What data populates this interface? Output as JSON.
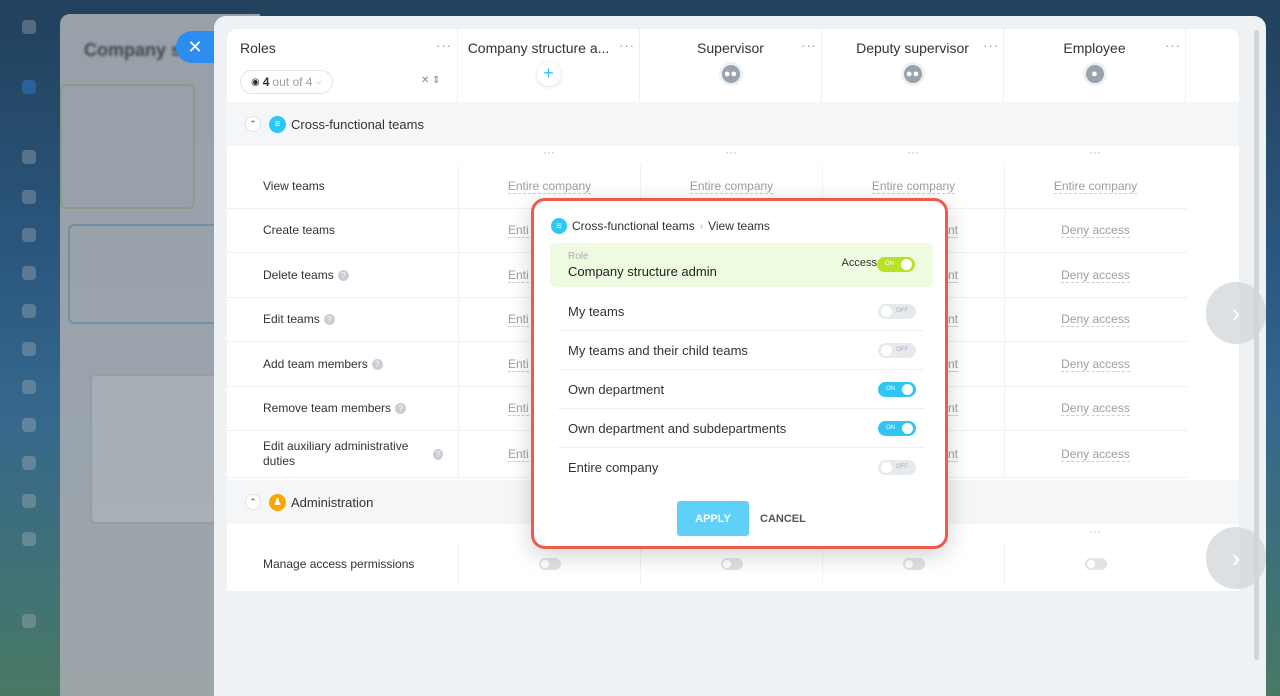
{
  "header": {
    "roles_label": "Roles",
    "filter": {
      "count": "4",
      "suffix": "out of 4"
    },
    "columns": [
      {
        "label": "Company structure a...",
        "icon": "plus-icon"
      },
      {
        "label": "Supervisor",
        "icon": "group-icon"
      },
      {
        "label": "Deputy supervisor",
        "icon": "group-icon"
      },
      {
        "label": "Employee",
        "icon": "person-icon"
      }
    ],
    "more": "···"
  },
  "sections": [
    {
      "label": "Cross-functional teams",
      "color": "#2fc6f6",
      "icon": "teams-icon"
    },
    {
      "label": "Administration",
      "color": "#f7a700",
      "icon": "admin-icon"
    }
  ],
  "rows": [
    {
      "name": "View teams",
      "help": false,
      "values": [
        "Entire company",
        "Entire company",
        "Entire company",
        "Entire company"
      ]
    },
    {
      "name": "Create teams",
      "help": false,
      "values": [
        "Enti",
        "",
        "nt",
        "Deny access"
      ]
    },
    {
      "name": "Delete teams",
      "help": true,
      "values": [
        "Enti",
        "",
        "nt",
        "Deny access"
      ]
    },
    {
      "name": "Edit teams",
      "help": true,
      "values": [
        "Enti",
        "",
        "nt",
        "Deny access"
      ]
    },
    {
      "name": "Add team members",
      "help": true,
      "values": [
        "Enti",
        "",
        "nt",
        "Deny access"
      ]
    },
    {
      "name": "Remove team members",
      "help": true,
      "values": [
        "Enti",
        "",
        "nt",
        "Deny access"
      ]
    },
    {
      "name": "Edit auxiliary administrative duties",
      "help": true,
      "values": [
        "Enti",
        "",
        "nt",
        "Deny access"
      ]
    }
  ],
  "admin_row": {
    "name": "Manage access permissions"
  },
  "popup": {
    "crumb_section": "Cross-functional teams",
    "crumb_item": "View teams",
    "role_small": "Role",
    "role_name": "Company structure admin",
    "access_label": "Access",
    "access_on": "ON",
    "options": [
      {
        "label": "My teams",
        "state": "OFF"
      },
      {
        "label": "My teams and their child teams",
        "state": "OFF"
      },
      {
        "label": "Own department",
        "state": "ON"
      },
      {
        "label": "Own department and subdepartments",
        "state": "ON"
      },
      {
        "label": "Entire company",
        "state": "OFF"
      }
    ],
    "apply": "APPLY",
    "cancel": "CANCEL"
  },
  "colors": {
    "accent": "#2fc6f6",
    "highlight_border": "#ef5a4a",
    "apply": "#5fd0f6"
  }
}
